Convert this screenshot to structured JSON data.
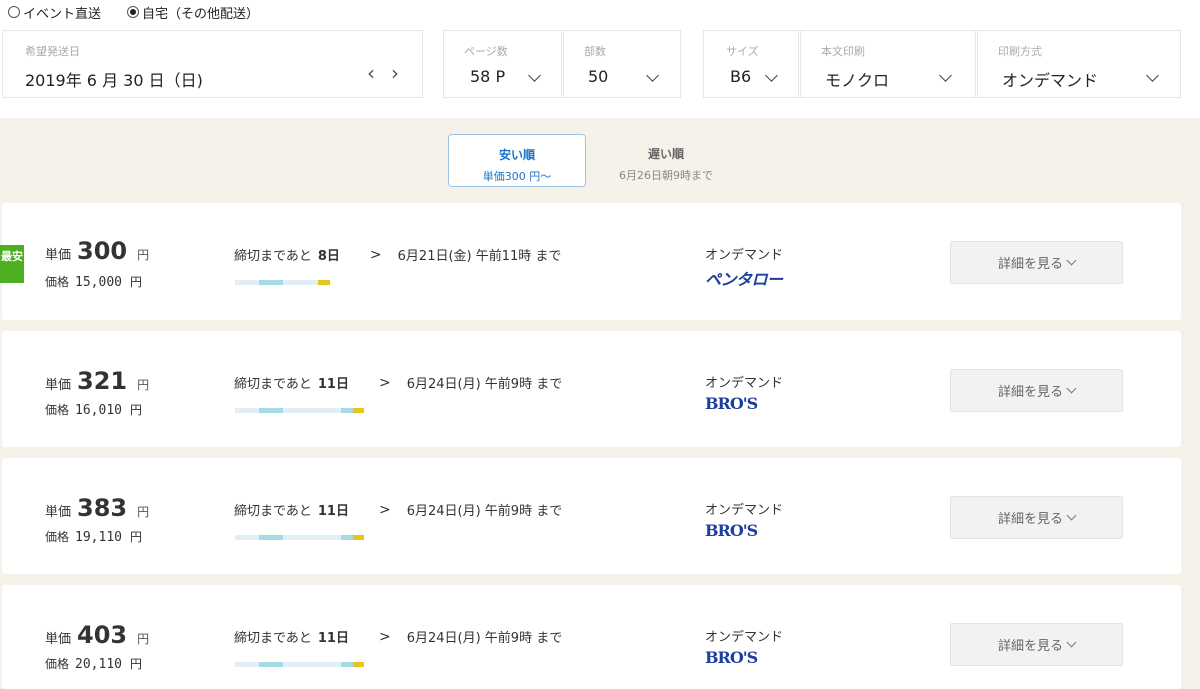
{
  "delivery": {
    "options": [
      {
        "label": "イベント直送",
        "checked": false
      },
      {
        "label": "自宅（その他配送）",
        "checked": true
      }
    ]
  },
  "filters": {
    "date": {
      "label": "希望発送日",
      "value": "2019年 6 月 30 日（日)",
      "prev": "‹",
      "next": "›"
    },
    "pages": {
      "label": "ページ数",
      "value": "58 P"
    },
    "copies": {
      "label": "部数",
      "value": "50"
    },
    "size": {
      "label": "サイズ",
      "value": "B6"
    },
    "body_print": {
      "label": "本文印刷",
      "value": "モノクロ"
    },
    "print_method": {
      "label": "印刷方式",
      "value": "オンデマンド"
    }
  },
  "sort_tabs": [
    {
      "title": "安い順",
      "sub": "単価300 円〜",
      "active": true
    },
    {
      "title": "遅い順",
      "sub": "6月26日朝9時まで",
      "active": false
    }
  ],
  "results": [
    {
      "badge": "最安",
      "unit_label": "単価",
      "unit_price": "300",
      "yen": "円",
      "price_label": "価格",
      "price": "15,000",
      "price_yen": "円",
      "deadline_prefix": "締切まであと",
      "days": "8日",
      "gt": ">",
      "deadline": "6月21日(金) 午前11時 まで",
      "method": "オンデマンド",
      "printer": "ペンタロー",
      "detail": "詳細を見る"
    },
    {
      "badge": "",
      "unit_label": "単価",
      "unit_price": "321",
      "yen": "円",
      "price_label": "価格",
      "price": "16,010",
      "price_yen": "円",
      "deadline_prefix": "締切まであと",
      "days": "11日",
      "gt": ">",
      "deadline": "6月24日(月) 午前9時 まで",
      "method": "オンデマンド",
      "printer": "BRO'S",
      "detail": "詳細を見る"
    },
    {
      "badge": "",
      "unit_label": "単価",
      "unit_price": "383",
      "yen": "円",
      "price_label": "価格",
      "price": "19,110",
      "price_yen": "円",
      "deadline_prefix": "締切まであと",
      "days": "11日",
      "gt": ">",
      "deadline": "6月24日(月) 午前9時 まで",
      "method": "オンデマンド",
      "printer": "BRO'S",
      "detail": "詳細を見る"
    },
    {
      "badge": "",
      "unit_label": "単価",
      "unit_price": "403",
      "yen": "円",
      "price_label": "価格",
      "price": "20,110",
      "price_yen": "円",
      "deadline_prefix": "締切まであと",
      "days": "11日",
      "gt": ">",
      "deadline": "6月24日(月) 午前9時 まで",
      "method": "オンデマンド",
      "printer": "BRO'S",
      "detail": "詳細を見る"
    }
  ],
  "colors": {
    "accent": "#1a73c9",
    "badge": "#4caf1f",
    "bar_base": "#e0eff3",
    "bar_mid": "#a6dbe5",
    "bar_end": "#e6c619",
    "logo": "#1c3e9c",
    "beige": "#f5f2ea"
  }
}
